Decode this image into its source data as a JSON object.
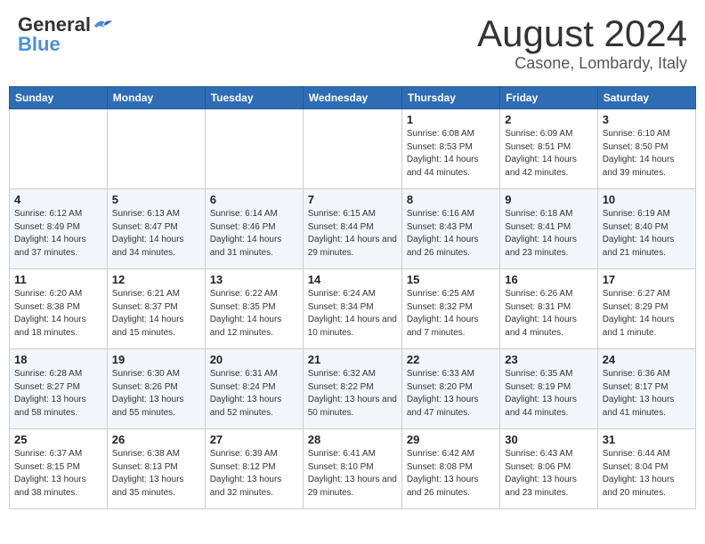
{
  "header": {
    "logo_general": "General",
    "logo_blue": "Blue",
    "month_title": "August 2024",
    "location": "Casone, Lombardy, Italy"
  },
  "columns": [
    "Sunday",
    "Monday",
    "Tuesday",
    "Wednesday",
    "Thursday",
    "Friday",
    "Saturday"
  ],
  "weeks": [
    [
      {
        "day": "",
        "info": ""
      },
      {
        "day": "",
        "info": ""
      },
      {
        "day": "",
        "info": ""
      },
      {
        "day": "",
        "info": ""
      },
      {
        "day": "1",
        "info": "Sunrise: 6:08 AM\nSunset: 8:53 PM\nDaylight: 14 hours and 44 minutes."
      },
      {
        "day": "2",
        "info": "Sunrise: 6:09 AM\nSunset: 8:51 PM\nDaylight: 14 hours and 42 minutes."
      },
      {
        "day": "3",
        "info": "Sunrise: 6:10 AM\nSunset: 8:50 PM\nDaylight: 14 hours and 39 minutes."
      }
    ],
    [
      {
        "day": "4",
        "info": "Sunrise: 6:12 AM\nSunset: 8:49 PM\nDaylight: 14 hours and 37 minutes."
      },
      {
        "day": "5",
        "info": "Sunrise: 6:13 AM\nSunset: 8:47 PM\nDaylight: 14 hours and 34 minutes."
      },
      {
        "day": "6",
        "info": "Sunrise: 6:14 AM\nSunset: 8:46 PM\nDaylight: 14 hours and 31 minutes."
      },
      {
        "day": "7",
        "info": "Sunrise: 6:15 AM\nSunset: 8:44 PM\nDaylight: 14 hours and 29 minutes."
      },
      {
        "day": "8",
        "info": "Sunrise: 6:16 AM\nSunset: 8:43 PM\nDaylight: 14 hours and 26 minutes."
      },
      {
        "day": "9",
        "info": "Sunrise: 6:18 AM\nSunset: 8:41 PM\nDaylight: 14 hours and 23 minutes."
      },
      {
        "day": "10",
        "info": "Sunrise: 6:19 AM\nSunset: 8:40 PM\nDaylight: 14 hours and 21 minutes."
      }
    ],
    [
      {
        "day": "11",
        "info": "Sunrise: 6:20 AM\nSunset: 8:38 PM\nDaylight: 14 hours and 18 minutes."
      },
      {
        "day": "12",
        "info": "Sunrise: 6:21 AM\nSunset: 8:37 PM\nDaylight: 14 hours and 15 minutes."
      },
      {
        "day": "13",
        "info": "Sunrise: 6:22 AM\nSunset: 8:35 PM\nDaylight: 14 hours and 12 minutes."
      },
      {
        "day": "14",
        "info": "Sunrise: 6:24 AM\nSunset: 8:34 PM\nDaylight: 14 hours and 10 minutes."
      },
      {
        "day": "15",
        "info": "Sunrise: 6:25 AM\nSunset: 8:32 PM\nDaylight: 14 hours and 7 minutes."
      },
      {
        "day": "16",
        "info": "Sunrise: 6:26 AM\nSunset: 8:31 PM\nDaylight: 14 hours and 4 minutes."
      },
      {
        "day": "17",
        "info": "Sunrise: 6:27 AM\nSunset: 8:29 PM\nDaylight: 14 hours and 1 minute."
      }
    ],
    [
      {
        "day": "18",
        "info": "Sunrise: 6:28 AM\nSunset: 8:27 PM\nDaylight: 13 hours and 58 minutes."
      },
      {
        "day": "19",
        "info": "Sunrise: 6:30 AM\nSunset: 8:26 PM\nDaylight: 13 hours and 55 minutes."
      },
      {
        "day": "20",
        "info": "Sunrise: 6:31 AM\nSunset: 8:24 PM\nDaylight: 13 hours and 52 minutes."
      },
      {
        "day": "21",
        "info": "Sunrise: 6:32 AM\nSunset: 8:22 PM\nDaylight: 13 hours and 50 minutes."
      },
      {
        "day": "22",
        "info": "Sunrise: 6:33 AM\nSunset: 8:20 PM\nDaylight: 13 hours and 47 minutes."
      },
      {
        "day": "23",
        "info": "Sunrise: 6:35 AM\nSunset: 8:19 PM\nDaylight: 13 hours and 44 minutes."
      },
      {
        "day": "24",
        "info": "Sunrise: 6:36 AM\nSunset: 8:17 PM\nDaylight: 13 hours and 41 minutes."
      }
    ],
    [
      {
        "day": "25",
        "info": "Sunrise: 6:37 AM\nSunset: 8:15 PM\nDaylight: 13 hours and 38 minutes."
      },
      {
        "day": "26",
        "info": "Sunrise: 6:38 AM\nSunset: 8:13 PM\nDaylight: 13 hours and 35 minutes."
      },
      {
        "day": "27",
        "info": "Sunrise: 6:39 AM\nSunset: 8:12 PM\nDaylight: 13 hours and 32 minutes."
      },
      {
        "day": "28",
        "info": "Sunrise: 6:41 AM\nSunset: 8:10 PM\nDaylight: 13 hours and 29 minutes."
      },
      {
        "day": "29",
        "info": "Sunrise: 6:42 AM\nSunset: 8:08 PM\nDaylight: 13 hours and 26 minutes."
      },
      {
        "day": "30",
        "info": "Sunrise: 6:43 AM\nSunset: 8:06 PM\nDaylight: 13 hours and 23 minutes."
      },
      {
        "day": "31",
        "info": "Sunrise: 6:44 AM\nSunset: 8:04 PM\nDaylight: 13 hours and 20 minutes."
      }
    ]
  ]
}
